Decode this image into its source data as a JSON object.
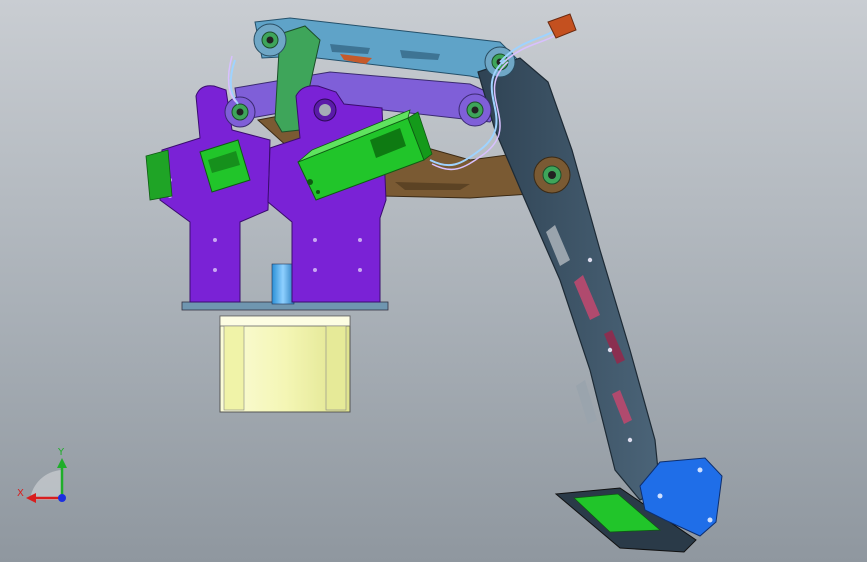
{
  "viewport": {
    "background_top": "#c9cdd2",
    "background_bottom": "#8f979f"
  },
  "axis_triad": {
    "x_label": "X",
    "y_label": "Y",
    "x_color": "#d81e1e",
    "y_color": "#1fae2a",
    "z_color": "#1c2fe0"
  },
  "colors": {
    "bracket_purple": "#7a22d6",
    "servo_green": "#21c52a",
    "link_blue": "#5fa3c8",
    "link_green": "#3ea55a",
    "link_lavender": "#7f5fd8",
    "link_brown": "#7a5a33",
    "arm_slate": "#3d5366",
    "gripper_blue": "#1f6ee8",
    "stepper_yellow": "#f4f6b5",
    "connector_orange": "#c4501f"
  },
  "icons": {
    "axis": "axis-triad-icon",
    "servo": "servo-motor-icon"
  }
}
